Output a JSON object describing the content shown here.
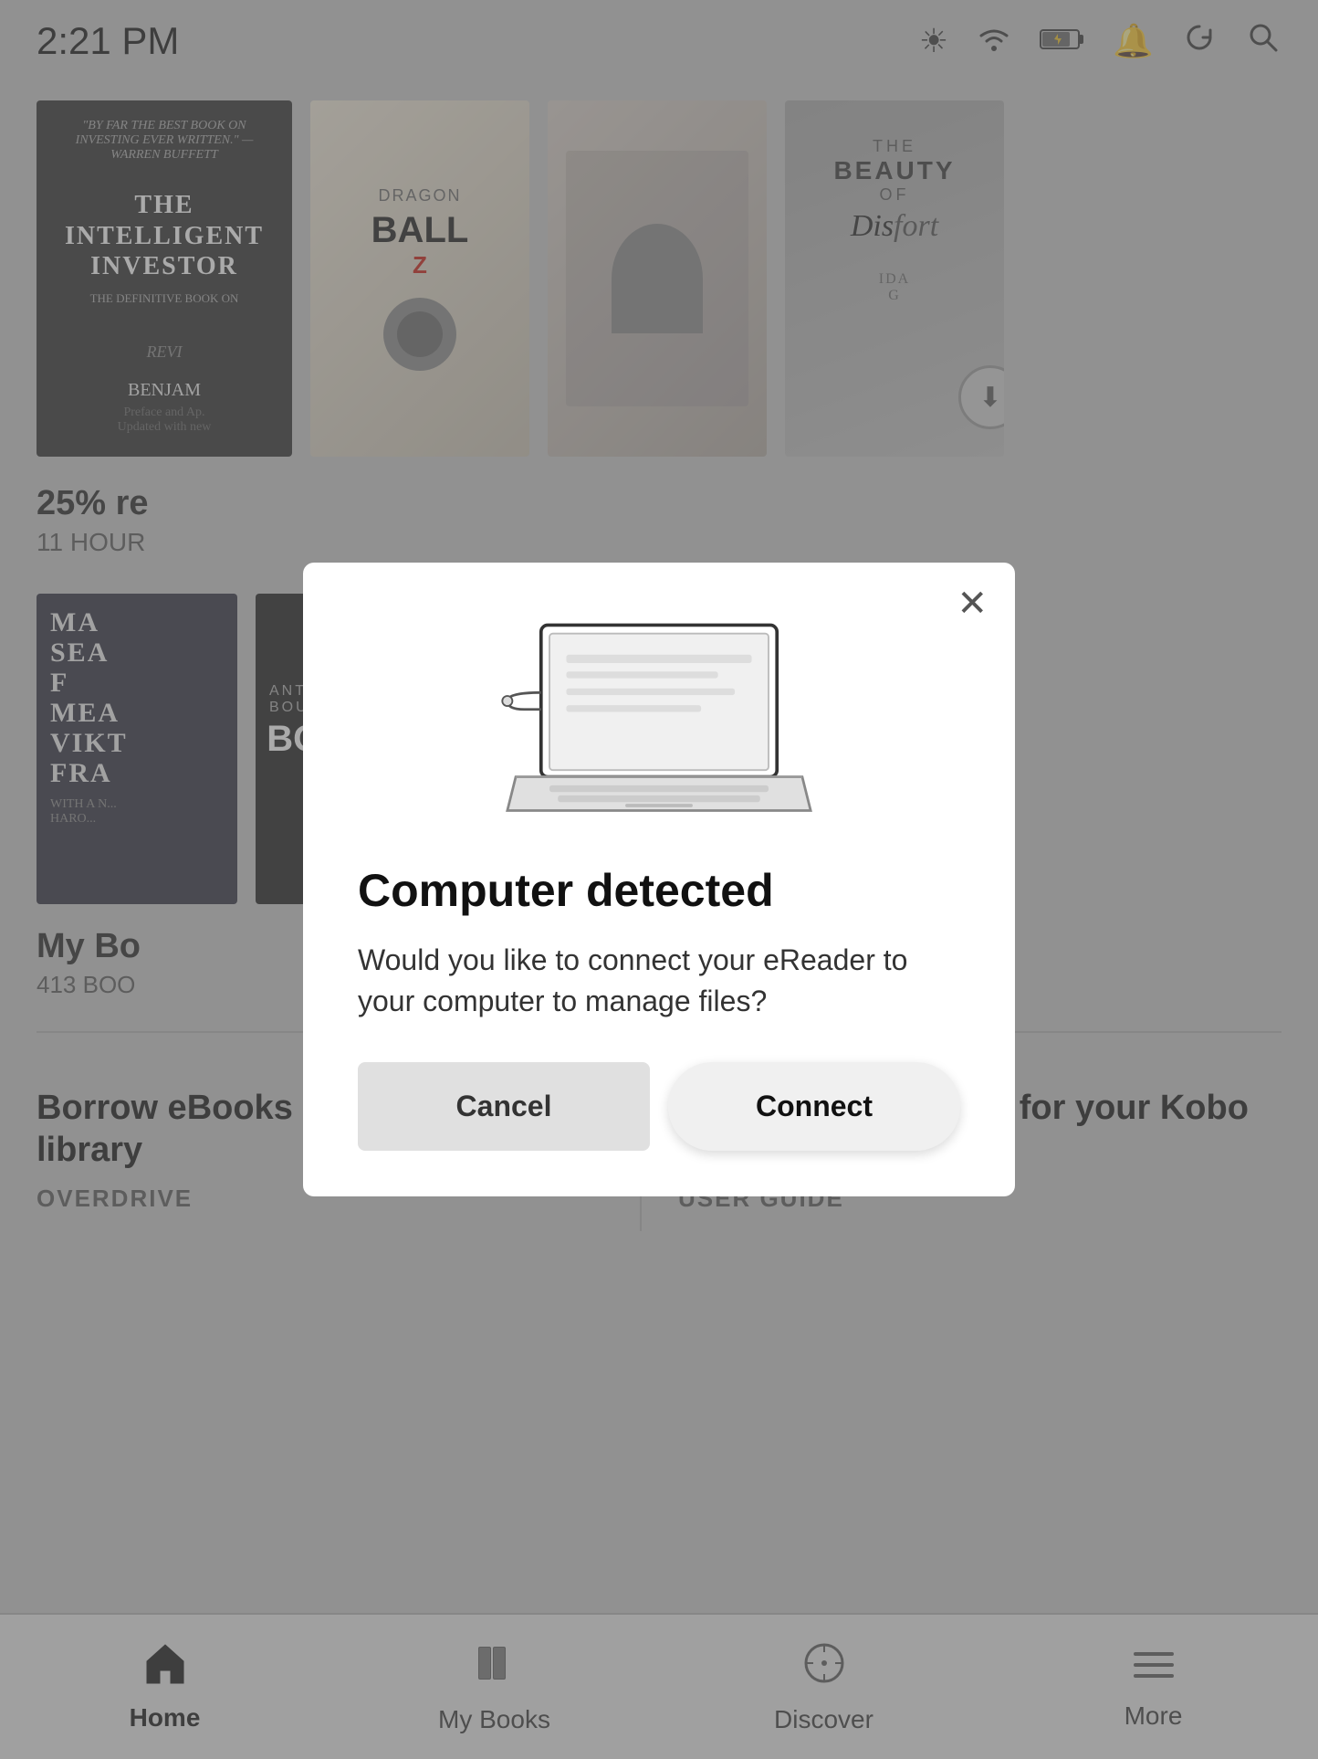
{
  "statusBar": {
    "time": "2:21 PM"
  },
  "books": [
    {
      "id": "intelligent-investor",
      "quote": "\"BY FAR THE BEST BOOK ON INVESTING EVER WRITTEN.\" —WARREN BUFFETT",
      "title": "THE INTELLIGENT INVESTOR",
      "subtitle": "THE DEFINITIVE BOOK ON",
      "author": "BENJAM",
      "progress": "25% re",
      "timeLeft": "11 HOUR"
    },
    {
      "id": "dragonball",
      "title": "DRAGON BALL",
      "subtitle": "Z"
    },
    {
      "id": "manga3",
      "title": ""
    },
    {
      "id": "beauty-discomfort",
      "title": "THE BEAUTY OF",
      "subtitle": "Discomfort",
      "hasDownload": true
    }
  ],
  "myBooks": {
    "label": "My Bo",
    "count": "413 BOO"
  },
  "promoCards": [
    {
      "title": "Borrow eBooks from your public library",
      "subtitle": "OVERDRIVE"
    },
    {
      "title": "Read the user guide for your Kobo Forma",
      "subtitle": "USER GUIDE"
    }
  ],
  "bottomNav": [
    {
      "id": "home",
      "label": "Home",
      "icon": "🏠",
      "active": true
    },
    {
      "id": "my-books",
      "label": "My Books",
      "icon": "📚",
      "active": false
    },
    {
      "id": "discover",
      "label": "Discover",
      "icon": "🧭",
      "active": false
    },
    {
      "id": "more",
      "label": "More",
      "icon": "☰",
      "active": false
    }
  ],
  "modal": {
    "title": "Computer detected",
    "body": "Would you like to connect your eReader to your computer to manage files?",
    "cancelLabel": "Cancel",
    "connectLabel": "Connect"
  }
}
